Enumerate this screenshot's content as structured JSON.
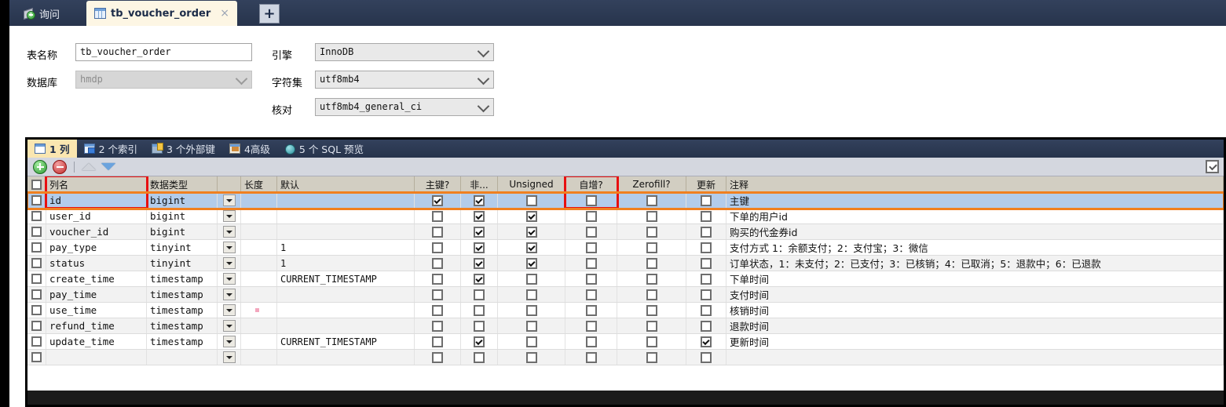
{
  "window": {
    "tabs": {
      "query_label": "询问",
      "active_label": "tb_voucher_order",
      "close_label": "×",
      "plus_label": "+"
    }
  },
  "form": {
    "table_name_label": "表名称",
    "table_name_value": "tb_voucher_order",
    "database_label": "数据库",
    "database_value": "hmdp",
    "engine_label": "引擎",
    "engine_value": "InnoDB",
    "charset_label": "字符集",
    "charset_value": "utf8mb4",
    "collation_label": "核对",
    "collation_value": "utf8mb4_general_ci"
  },
  "subtabs": [
    {
      "label": "1 列",
      "icon": "table-icon",
      "active": true
    },
    {
      "label": "2 个索引",
      "icon": "index-icon",
      "active": false
    },
    {
      "label": "3 个外部键",
      "icon": "foreign-key-icon",
      "active": false
    },
    {
      "label": "4高级",
      "icon": "advanced-icon",
      "active": false
    },
    {
      "label": "5 个 SQL 预览",
      "icon": "sql-preview-icon",
      "active": false
    }
  ],
  "toolbar": {
    "add_label": "添加栏位",
    "delete_label": "删除栏位",
    "move_up_label": "上移",
    "move_down_label": "下移"
  },
  "grid": {
    "headers": [
      "",
      "列名",
      "数据类型",
      "",
      "长度",
      "默认",
      "主键?",
      "非...",
      "Unsigned",
      "自增?",
      "Zerofill?",
      "更新",
      "注释"
    ],
    "highlighted_headers": [
      "列名",
      "自增?"
    ],
    "rows": [
      {
        "name": "id",
        "type": "bigint",
        "length": "",
        "default": "",
        "pk": true,
        "notnull": true,
        "unsigned": false,
        "autoinc": false,
        "zerofill": false,
        "update": false,
        "comment": "主键",
        "selected": true
      },
      {
        "name": "user_id",
        "type": "bigint",
        "length": "",
        "default": "",
        "pk": false,
        "notnull": true,
        "unsigned": true,
        "autoinc": false,
        "zerofill": false,
        "update": false,
        "comment": "下单的用户id",
        "selected": false
      },
      {
        "name": "voucher_id",
        "type": "bigint",
        "length": "",
        "default": "",
        "pk": false,
        "notnull": true,
        "unsigned": true,
        "autoinc": false,
        "zerofill": false,
        "update": false,
        "comment": "购买的代金券id",
        "selected": false
      },
      {
        "name": "pay_type",
        "type": "tinyint",
        "length": "",
        "default": "1",
        "pk": false,
        "notnull": true,
        "unsigned": true,
        "autoinc": false,
        "zerofill": false,
        "update": false,
        "comment": "支付方式 1：余额支付；2：支付宝；3：微信",
        "selected": false
      },
      {
        "name": "status",
        "type": "tinyint",
        "length": "",
        "default": "1",
        "pk": false,
        "notnull": true,
        "unsigned": true,
        "autoinc": false,
        "zerofill": false,
        "update": false,
        "comment": "订单状态，1：未支付；2：已支付；3：已核销；4：已取消；5：退款中；6：已退款",
        "selected": false
      },
      {
        "name": "create_time",
        "type": "timestamp",
        "length": "",
        "default": "CURRENT_TIMESTAMP",
        "pk": false,
        "notnull": true,
        "unsigned": false,
        "autoinc": false,
        "zerofill": false,
        "update": false,
        "comment": "下单时间",
        "selected": false
      },
      {
        "name": "pay_time",
        "type": "timestamp",
        "length": "",
        "default": "",
        "pk": false,
        "notnull": false,
        "unsigned": false,
        "autoinc": false,
        "zerofill": false,
        "update": false,
        "comment": "支付时间",
        "selected": false
      },
      {
        "name": "use_time",
        "type": "timestamp",
        "length": "",
        "default": "",
        "pk": false,
        "notnull": false,
        "unsigned": false,
        "autoinc": false,
        "zerofill": false,
        "update": false,
        "comment": "核销时间",
        "selected": false
      },
      {
        "name": "refund_time",
        "type": "timestamp",
        "length": "",
        "default": "",
        "pk": false,
        "notnull": false,
        "unsigned": false,
        "autoinc": false,
        "zerofill": false,
        "update": false,
        "comment": "退款时间",
        "selected": false
      },
      {
        "name": "update_time",
        "type": "timestamp",
        "length": "",
        "default": "CURRENT_TIMESTAMP",
        "pk": false,
        "notnull": true,
        "unsigned": false,
        "autoinc": false,
        "zerofill": false,
        "update": true,
        "comment": "更新时间",
        "selected": false
      },
      {
        "name": "",
        "type": "",
        "length": "",
        "default": "",
        "pk": false,
        "notnull": false,
        "unsigned": false,
        "autoinc": false,
        "zerofill": false,
        "update": false,
        "comment": "",
        "selected": false
      }
    ]
  },
  "colors": {
    "accent_orange": "#f08020",
    "accent_red": "#e81010",
    "selection_blue": "#b3ccea",
    "tab_active_yellow": "#fae6b0",
    "titlebar": "#2b3a55"
  }
}
